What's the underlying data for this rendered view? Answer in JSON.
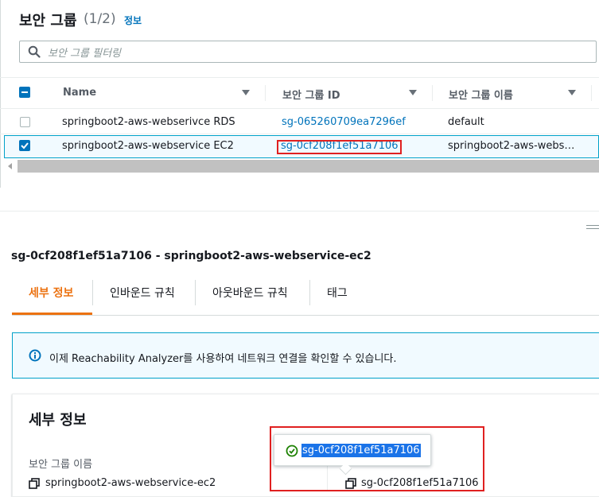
{
  "header": {
    "title": "보안 그룹",
    "count": "(1/2)",
    "info_link": "정보"
  },
  "search": {
    "placeholder": "보안 그룹 필터링"
  },
  "table": {
    "columns": [
      "Name",
      "보안 그룹 ID",
      "보안 그룹 이름"
    ],
    "rows": [
      {
        "checked": false,
        "name": "springboot2-aws-webserivce RDS",
        "sg_id": "sg-065260709ea7296ef",
        "sg_name": "default"
      },
      {
        "checked": true,
        "name": "springboot2-aws-webservice EC2",
        "sg_id": "sg-0cf208f1ef51a7106",
        "sg_name": "springboot2-aws-webs…"
      }
    ]
  },
  "detail": {
    "title": "sg-0cf208f1ef51a7106 - springboot2-aws-webservice-ec2",
    "tabs": [
      "세부 정보",
      "인바운드 규칙",
      "아웃바운드 규칙",
      "태그"
    ],
    "active_tab": "세부 정보",
    "banner_text": "이제 Reachability Analyzer를 사용하여 네트워크 연결을 확인할 수 있습니다.",
    "card_title": "세부 정보",
    "fields": {
      "sg_name_label": "보안 그룹 이름",
      "sg_name_value": "springboot2-aws-webservice-ec2",
      "sg_id_value": "sg-0cf208f1ef51a7106"
    },
    "popover_text": "sg-0cf208f1ef51a7106"
  },
  "colors": {
    "accent": "#ec7211",
    "link": "#0073bb",
    "annotation": "#e02020",
    "success": "#1d8102"
  }
}
